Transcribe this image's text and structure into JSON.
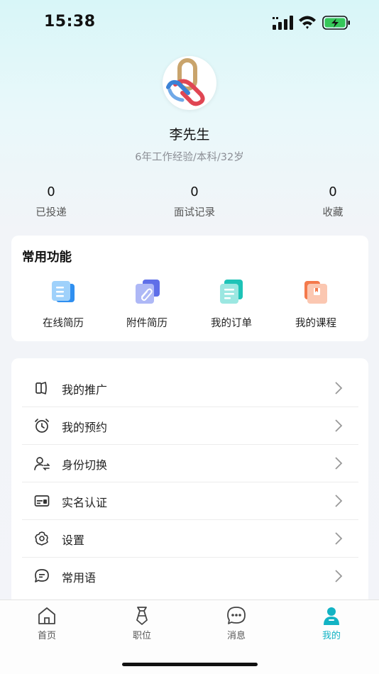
{
  "status_bar": {
    "time": "15:38"
  },
  "profile": {
    "name": "李先生",
    "description": "6年工作经验/本科/32岁"
  },
  "stats": [
    {
      "value": "0",
      "label": "已投递"
    },
    {
      "value": "0",
      "label": "面试记录"
    },
    {
      "value": "0",
      "label": "收藏"
    }
  ],
  "functions": {
    "title": "常用功能",
    "items": [
      {
        "label": "在线简历",
        "icon": "online-resume-icon"
      },
      {
        "label": "附件简历",
        "icon": "attachment-resume-icon"
      },
      {
        "label": "我的订单",
        "icon": "orders-icon"
      },
      {
        "label": "我的课程",
        "icon": "courses-icon"
      }
    ]
  },
  "menu": [
    {
      "label": "我的推广",
      "icon": "speaker-icon"
    },
    {
      "label": "我的预约",
      "icon": "alarm-clock-icon"
    },
    {
      "label": "身份切换",
      "icon": "user-switch-icon"
    },
    {
      "label": "实名认证",
      "icon": "id-card-icon"
    },
    {
      "label": "设置",
      "icon": "gear-icon"
    },
    {
      "label": "常用语",
      "icon": "chat-bubble-icon"
    }
  ],
  "tabs": [
    {
      "label": "首页",
      "icon": "home-icon"
    },
    {
      "label": "职位",
      "icon": "tie-icon"
    },
    {
      "label": "消息",
      "icon": "message-icon"
    },
    {
      "label": "我的",
      "icon": "person-icon",
      "active": true
    }
  ],
  "colors": {
    "accent": "#12b3c4",
    "background_top": "#d8f6f8",
    "card": "#ffffff"
  }
}
